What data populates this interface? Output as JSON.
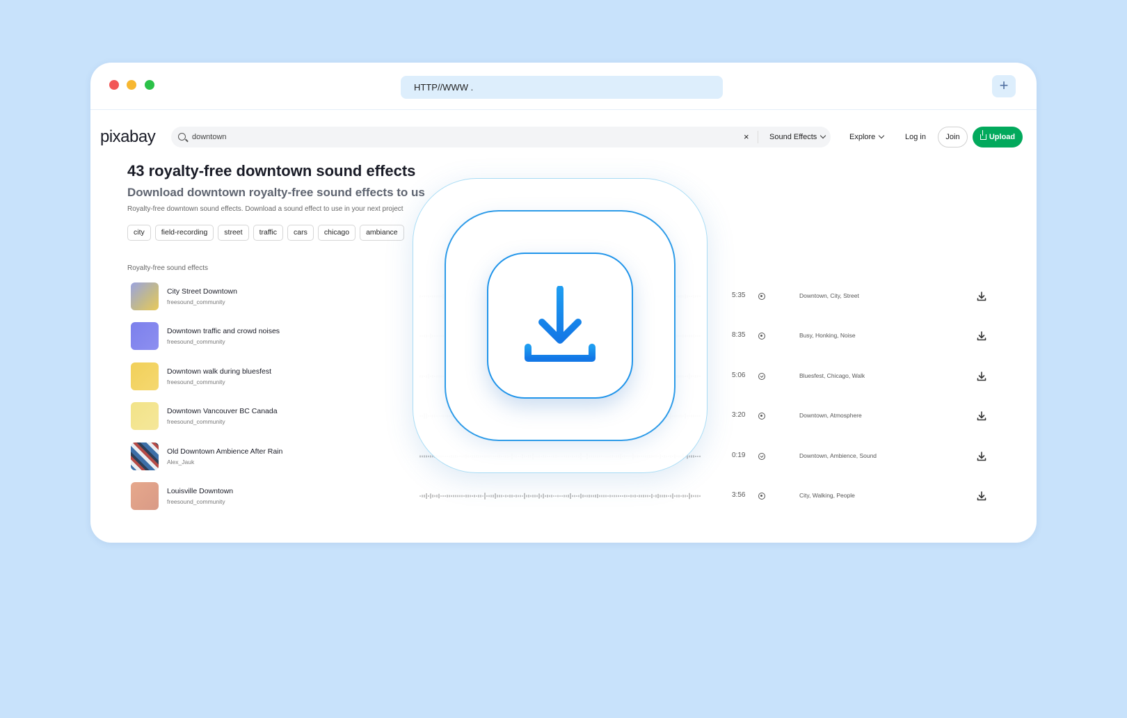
{
  "browser": {
    "url": "HTTP//WWW .",
    "new_tab_label": "+"
  },
  "site": {
    "logo": "pixabay",
    "search": {
      "value": "downtown",
      "placeholder": ""
    },
    "search_clear": "×",
    "search_type": "Sound Effects",
    "nav": {
      "explore": "Explore",
      "login": "Log in",
      "join": "Join",
      "upload": "Upload"
    },
    "brand_color": "#02a95c"
  },
  "page": {
    "title": "43 royalty-free downtown sound effects",
    "subtitle": "Download downtown royalty-free sound effects to us",
    "description": "Royalty-free downtown sound effects. Download a sound effect to use in your next project",
    "tags": [
      "city",
      "field-recording",
      "street",
      "traffic",
      "cars",
      "chicago",
      "ambiance"
    ],
    "section_label": "Royalty-free sound effects"
  },
  "tracks": [
    {
      "title": "City Street Downtown",
      "author": "freesound_community",
      "duration": "5:35",
      "status": "dot",
      "tags": "Downtown, City, Street",
      "thumb": "linear-gradient(135deg,#9aa3e0 0%,#c2b98c 55%,#e8c95a 100%)"
    },
    {
      "title": "Downtown traffic and crowd noises",
      "author": "freesound_community",
      "duration": "8:35",
      "status": "dot",
      "tags": "Busy, Honking, Noise",
      "thumb": "linear-gradient(135deg,#7c80ec 0%,#8d8ff0 100%)"
    },
    {
      "title": "Downtown walk during bluesfest",
      "author": "freesound_community",
      "duration": "5:06",
      "status": "check",
      "tags": "Bluesfest, Chicago, Walk",
      "thumb": "linear-gradient(135deg,#f1d05a 0%,#f5d870 100%)"
    },
    {
      "title": "Downtown Vancouver BC Canada",
      "author": "freesound_community",
      "duration": "3:20",
      "status": "dot",
      "tags": "Downtown, Atmosphere",
      "thumb": "linear-gradient(135deg,#f2e388 0%,#f5e79a 100%)"
    },
    {
      "title": "Old Downtown Ambience After Rain",
      "author": "Alex_Jauk",
      "duration": "0:19",
      "status": "check",
      "tags": "Downtown, Ambience, Sound",
      "thumb": "repeating-linear-gradient(45deg,#3c6fa8 0 6px,#e9eef3 6px 11px,#b54b46 11px 15px,#2d3f57 15px 19px)"
    },
    {
      "title": "Louisville Downtown",
      "author": "freesound_community",
      "duration": "3:56",
      "status": "dot",
      "tags": "City, Walking, People",
      "thumb": "linear-gradient(135deg,#e6a88c 0%,#d99a86 100%)"
    }
  ]
}
